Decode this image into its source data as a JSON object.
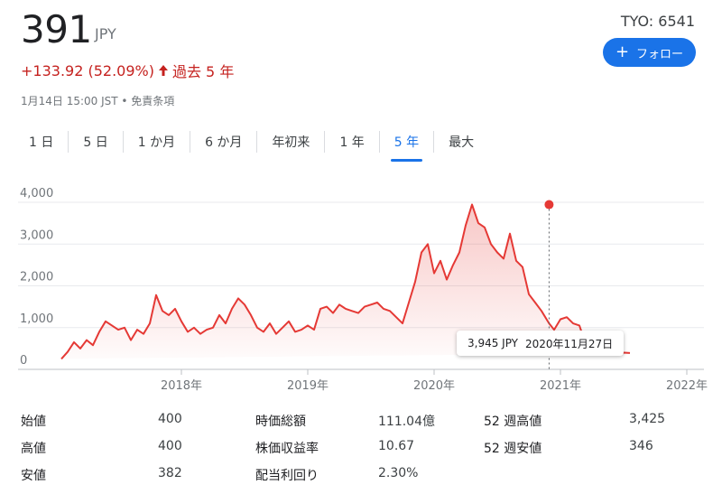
{
  "quote": {
    "price": "391",
    "currency": "JPY",
    "change": "+133.92 (52.09%)",
    "period": "過去 5 年",
    "timestamp": "1月14日 15:00 JST • 免責条項",
    "ticker": "TYO: 6541",
    "follow_label": "フォロー",
    "color_negative": "#c5221f",
    "accent": "#1a73e8"
  },
  "tabs": [
    {
      "label": "1 日"
    },
    {
      "label": "5 日"
    },
    {
      "label": "1 か月"
    },
    {
      "label": "6 か月"
    },
    {
      "label": "年初来"
    },
    {
      "label": "1 年"
    },
    {
      "label": "5 年",
      "active": true
    },
    {
      "label": "最大"
    }
  ],
  "tooltip": {
    "value": "3,945 JPY",
    "date": "2020年11月27日"
  },
  "stats": [
    {
      "l1": "始値",
      "v1": "400",
      "l2": "時価総額",
      "v2": "111.04億",
      "l3": "52 週高値",
      "v3": "3,425"
    },
    {
      "l1": "高値",
      "v1": "400",
      "l2": "株価収益率",
      "v2": "10.67",
      "l3": "52 週安値",
      "v3": "346"
    },
    {
      "l1": "安値",
      "v1": "382",
      "l2": "配当利回り",
      "v2": "2.30%",
      "l3": "",
      "v3": ""
    }
  ],
  "chart_data": {
    "type": "line",
    "x_start": 2017.05,
    "x_end": 2022.05,
    "xticks": [
      2018,
      2019,
      2020,
      2021,
      2022
    ],
    "xtick_labels": [
      "2018年",
      "2019年",
      "2020年",
      "2021年",
      "2022年"
    ],
    "ylim": [
      0,
      4000
    ],
    "yticks": [
      0,
      1000,
      2000,
      3000,
      4000
    ],
    "ytick_labels": [
      "0",
      "1,000",
      "2,000",
      "3,000",
      "4,000"
    ],
    "grid": true,
    "line_color": "#e53935",
    "highlight": {
      "x": 2020.91,
      "y": 3945
    },
    "x": [
      2017.05,
      2017.1,
      2017.15,
      2017.2,
      2017.25,
      2017.3,
      2017.35,
      2017.4,
      2017.45,
      2017.5,
      2017.55,
      2017.6,
      2017.65,
      2017.7,
      2017.75,
      2017.8,
      2017.85,
      2017.9,
      2017.95,
      2018.0,
      2018.05,
      2018.1,
      2018.15,
      2018.2,
      2018.25,
      2018.3,
      2018.35,
      2018.4,
      2018.45,
      2018.5,
      2018.55,
      2018.6,
      2018.65,
      2018.7,
      2018.75,
      2018.8,
      2018.85,
      2018.9,
      2018.95,
      2019.0,
      2019.05,
      2019.1,
      2019.15,
      2019.2,
      2019.25,
      2019.3,
      2019.35,
      2019.4,
      2019.45,
      2019.5,
      2019.55,
      2019.6,
      2019.65,
      2019.7,
      2019.75,
      2019.8,
      2019.85,
      2019.9,
      2019.95,
      2020.0,
      2020.05,
      2020.1,
      2020.15,
      2020.2,
      2020.25,
      2020.3,
      2020.35,
      2020.4,
      2020.45,
      2020.5,
      2020.55,
      2020.6,
      2020.65,
      2020.7,
      2020.75,
      2020.8,
      2020.85,
      2020.91,
      2020.95,
      2021.0,
      2021.05,
      2021.1,
      2021.15,
      2021.2,
      2021.25,
      2021.3,
      2021.35,
      2021.4,
      2021.45,
      2021.5,
      2021.55,
      2021.6,
      2021.65,
      2021.7,
      2021.75,
      2021.8,
      2021.85,
      2021.9,
      2021.95,
      2022.0,
      2022.05
    ],
    "y": [
      250,
      420,
      650,
      500,
      700,
      580,
      900,
      1150,
      1050,
      950,
      1000,
      700,
      950,
      850,
      1100,
      1780,
      1400,
      1300,
      1450,
      1150,
      900,
      1000,
      850,
      950,
      1000,
      1300,
      1100,
      1450,
      1700,
      1550,
      1300,
      1000,
      900,
      1100,
      850,
      1000,
      1150,
      900,
      950,
      1050,
      950,
      1450,
      1500,
      1350,
      1550,
      1450,
      1400,
      1350,
      1500,
      1550,
      1600,
      1450,
      1400,
      1250,
      1100,
      1600,
      2100,
      2800,
      3000,
      2300,
      2600,
      2150,
      2500,
      2800,
      3450,
      3945,
      3500,
      3400,
      3000,
      2800,
      2650,
      3250,
      2600,
      2450,
      1800,
      1600,
      1400,
      1100,
      950,
      1200,
      1250,
      1100,
      1050,
      600,
      450,
      380,
      360,
      370,
      380,
      400,
      391
    ]
  }
}
